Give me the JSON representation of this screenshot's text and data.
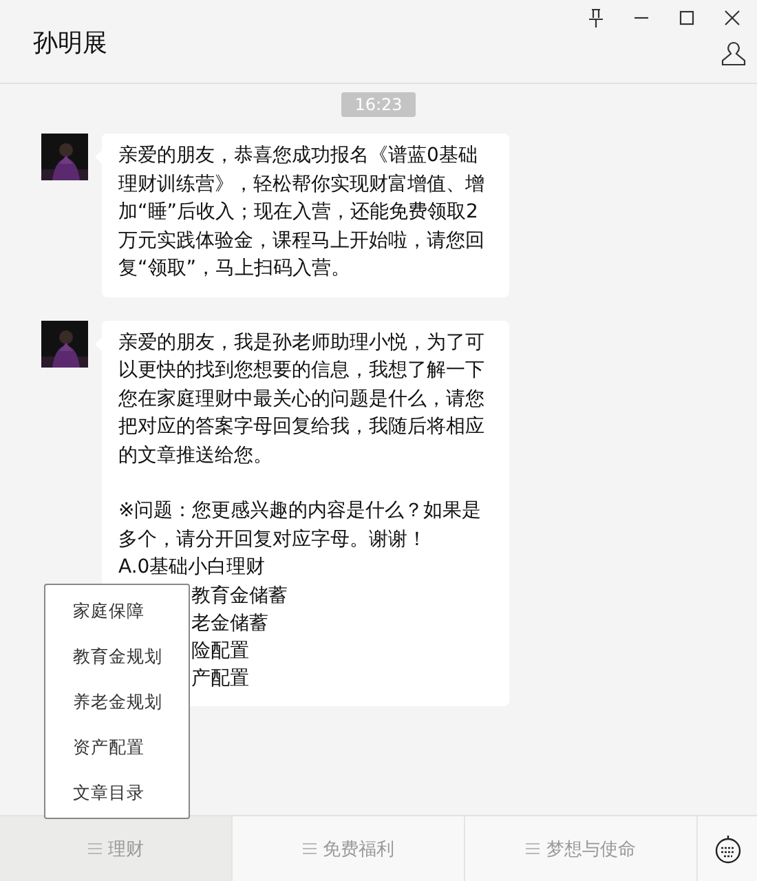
{
  "header": {
    "title": "孙明展"
  },
  "timestamp": "16:23",
  "messages": [
    {
      "kind": "text",
      "paragraphs": [
        "亲爱的朋友，恭喜您成功报名《谱蓝0基础理财训练营》，轻松帮你实现财富增值、增加“睡”后收入；现在入营，还能免费领取2万元实践体验金，课程马上开始啦，请您回复“领取”，马上扫码入营。"
      ]
    },
    {
      "kind": "text",
      "paragraphs": [
        "亲爱的朋友，我是孙老师助理小悦，为了可以更快的找到您想要的信息，我想了解一下您在家庭理财中最关心的问题是什么，请您把对应的答案字母回复给我，我随后将相应的文章推送给您。",
        "※问题：您更感兴趣的内容是什么？如果是多个，请分开回复对应字母。谢谢！",
        "A.0基础小白理财"
      ],
      "covered_lines": [
        "教育金储蓄",
        "老金储蓄",
        "险配置",
        "产配置"
      ]
    }
  ],
  "popup_menu": {
    "items": [
      "家庭保障",
      "教育金规划",
      "养老金规划",
      "资产配置",
      "文章目录"
    ]
  },
  "bottom_menu": {
    "items": [
      {
        "label": "理财",
        "selected": true
      },
      {
        "label": "免费福利",
        "selected": false
      },
      {
        "label": "梦想与使命",
        "selected": false
      }
    ]
  }
}
